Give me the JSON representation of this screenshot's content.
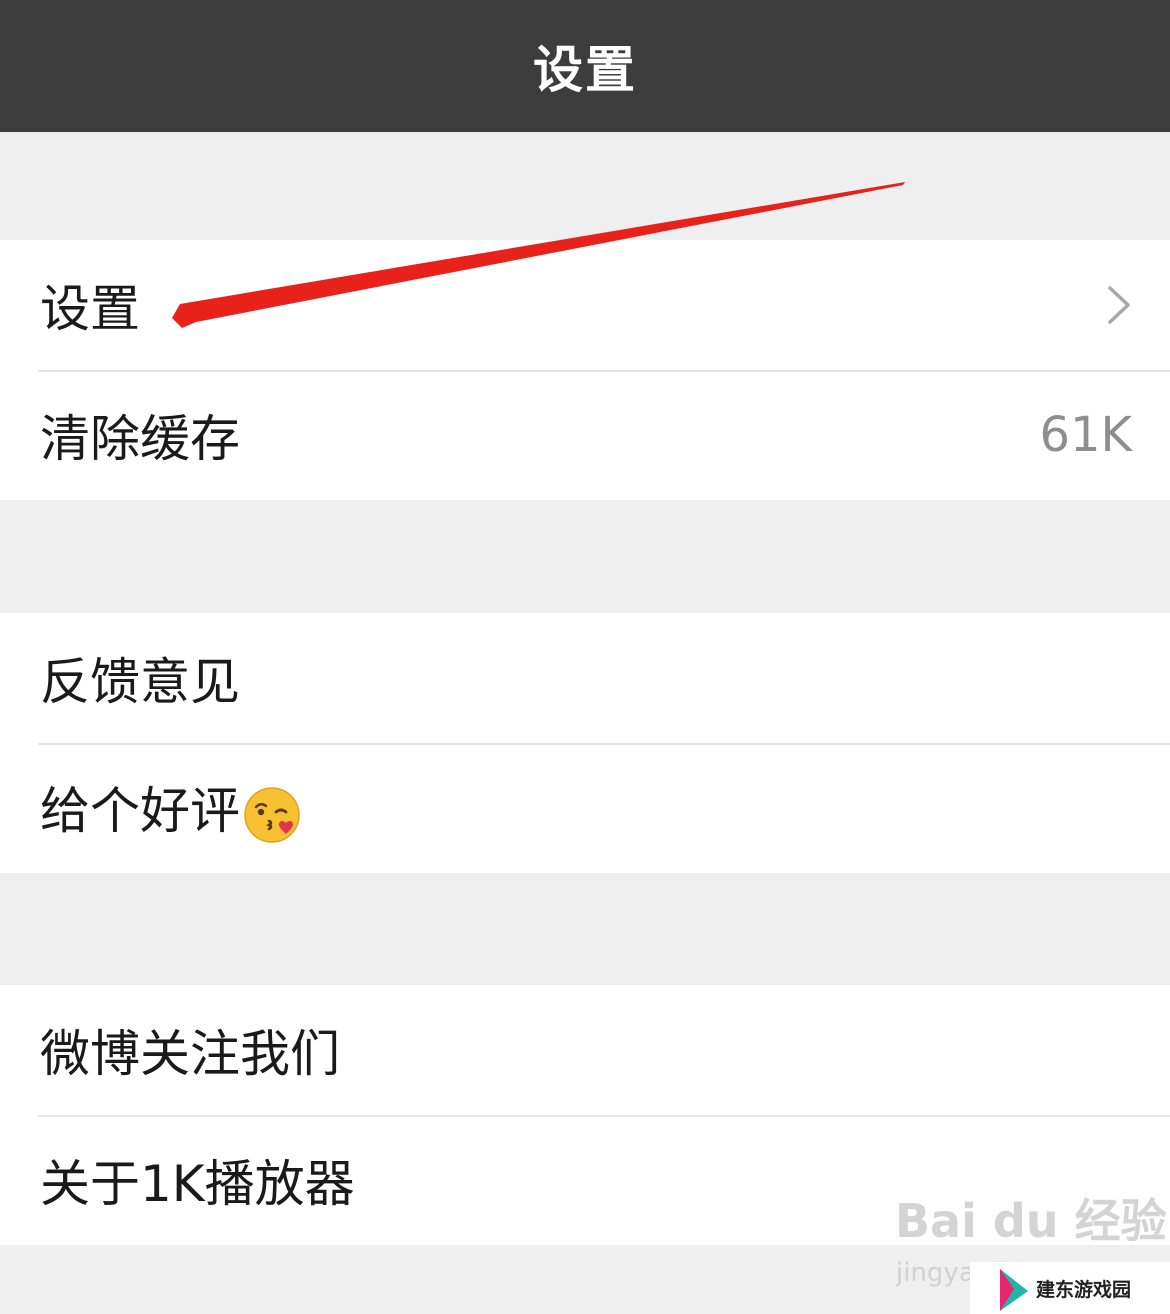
{
  "header": {
    "title": "设置"
  },
  "groups": [
    {
      "items": [
        {
          "label": "设置",
          "accessory": "chevron"
        },
        {
          "label": "清除缓存",
          "value": "61K"
        }
      ]
    },
    {
      "items": [
        {
          "label": "反馈意见"
        },
        {
          "label": "给个好评",
          "icon": "kissing-face-icon"
        }
      ]
    },
    {
      "items": [
        {
          "label": "微博关注我们"
        },
        {
          "label": "关于1K播放器"
        }
      ]
    }
  ],
  "watermark": {
    "logo_text": "Bai du 经验",
    "url_fragment": "jingya"
  },
  "badge": {
    "text": "建东游戏园"
  },
  "colors": {
    "nav_bg": "#3d3d3d",
    "page_bg": "#efefef",
    "annotation_arrow": "#e8221b"
  }
}
